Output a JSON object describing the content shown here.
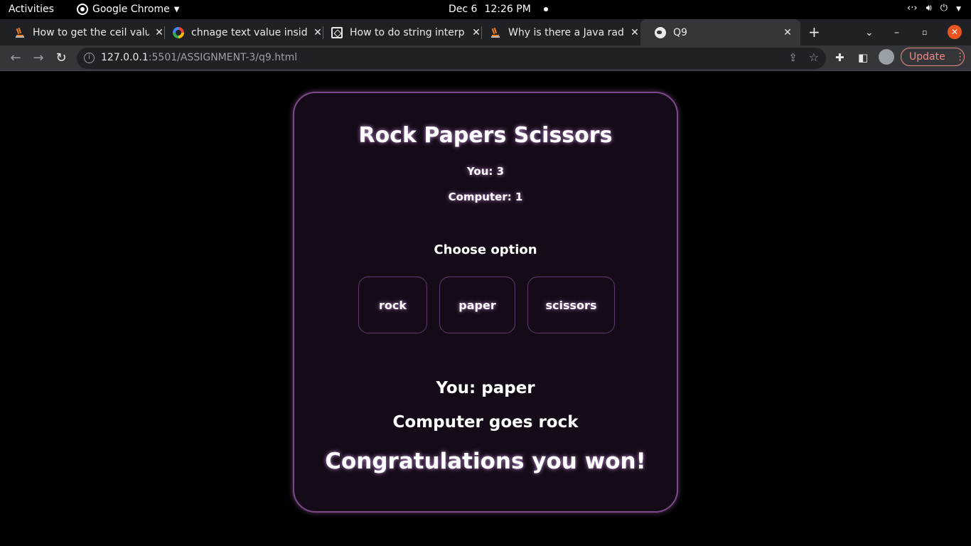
{
  "system": {
    "activities": "Activities",
    "app_name": "Google Chrome",
    "date": "Dec 6",
    "time": "12:26 PM"
  },
  "tabs": [
    {
      "title": "How to get the ceil valu",
      "icon": "stackoverflow-icon"
    },
    {
      "title": "chnage text value insid",
      "icon": "google-icon"
    },
    {
      "title": "How to do string interp",
      "icon": "geeksforgeeks-icon"
    },
    {
      "title": "Why is there a Java radi",
      "icon": "stackoverflow-icon"
    },
    {
      "title": "Q9",
      "icon": "globe-icon",
      "active": true
    }
  ],
  "address_bar": {
    "host": "127.0.0.1",
    "path": ":5501/ASSIGNMENT-3/q9.html"
  },
  "update_label": "Update",
  "game": {
    "title": "Rock Papers Scissors",
    "score_you": "You: 3",
    "score_computer": "Computer: 1",
    "choose_label": "Choose option",
    "options": [
      "rock",
      "paper",
      "scissors"
    ],
    "result_you": "You: paper",
    "result_computer": "Computer goes rock",
    "result_message": "Congratulations you won!"
  },
  "colors": {
    "card_background": "#150b18",
    "card_border": "#7b4a8a",
    "page_background": "#000000",
    "accent_update": "#f28b82"
  }
}
